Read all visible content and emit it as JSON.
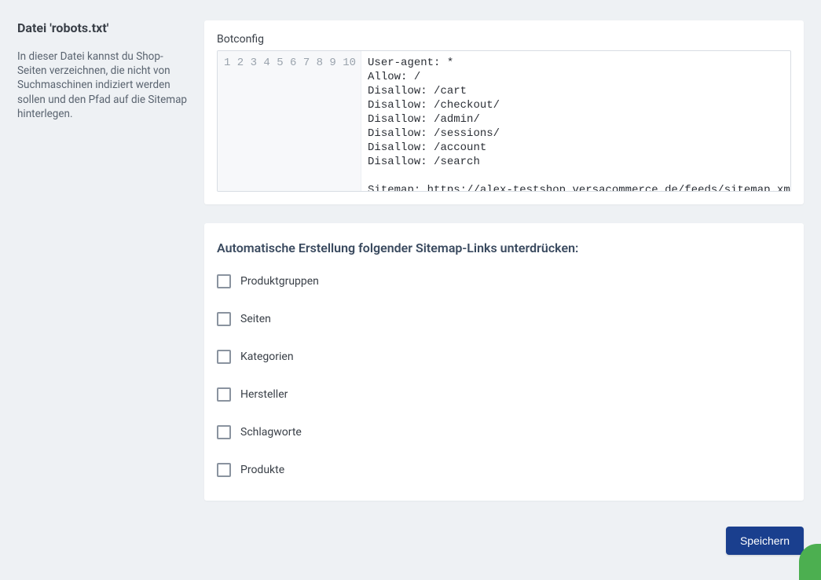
{
  "sidebar": {
    "title": "Datei 'robots.txt'",
    "description": "In dieser Datei kannst du Shop-Seiten verzeichnen, die nicht von Suchmaschinen indiziert werden sollen und den Pfad auf die Sitemap hinterlegen."
  },
  "editor": {
    "label": "Botconfig",
    "lines": [
      "User-agent: *",
      "Allow: /",
      "Disallow: /cart",
      "Disallow: /checkout/",
      "Disallow: /admin/",
      "Disallow: /sessions/",
      "Disallow: /account",
      "Disallow: /search",
      "",
      "Sitemap: https://alex-testshop.versacommerce.de/feeds/sitemap.xml"
    ]
  },
  "sitemap_card": {
    "title": "Automatische Erstellung folgender Sitemap-Links unterdrücken:",
    "options": [
      {
        "label": "Produktgruppen",
        "checked": false
      },
      {
        "label": "Seiten",
        "checked": false
      },
      {
        "label": "Kategorien",
        "checked": false
      },
      {
        "label": "Hersteller",
        "checked": false
      },
      {
        "label": "Schlagworte",
        "checked": false
      },
      {
        "label": "Produkte",
        "checked": false
      }
    ]
  },
  "buttons": {
    "save": "Speichern"
  }
}
